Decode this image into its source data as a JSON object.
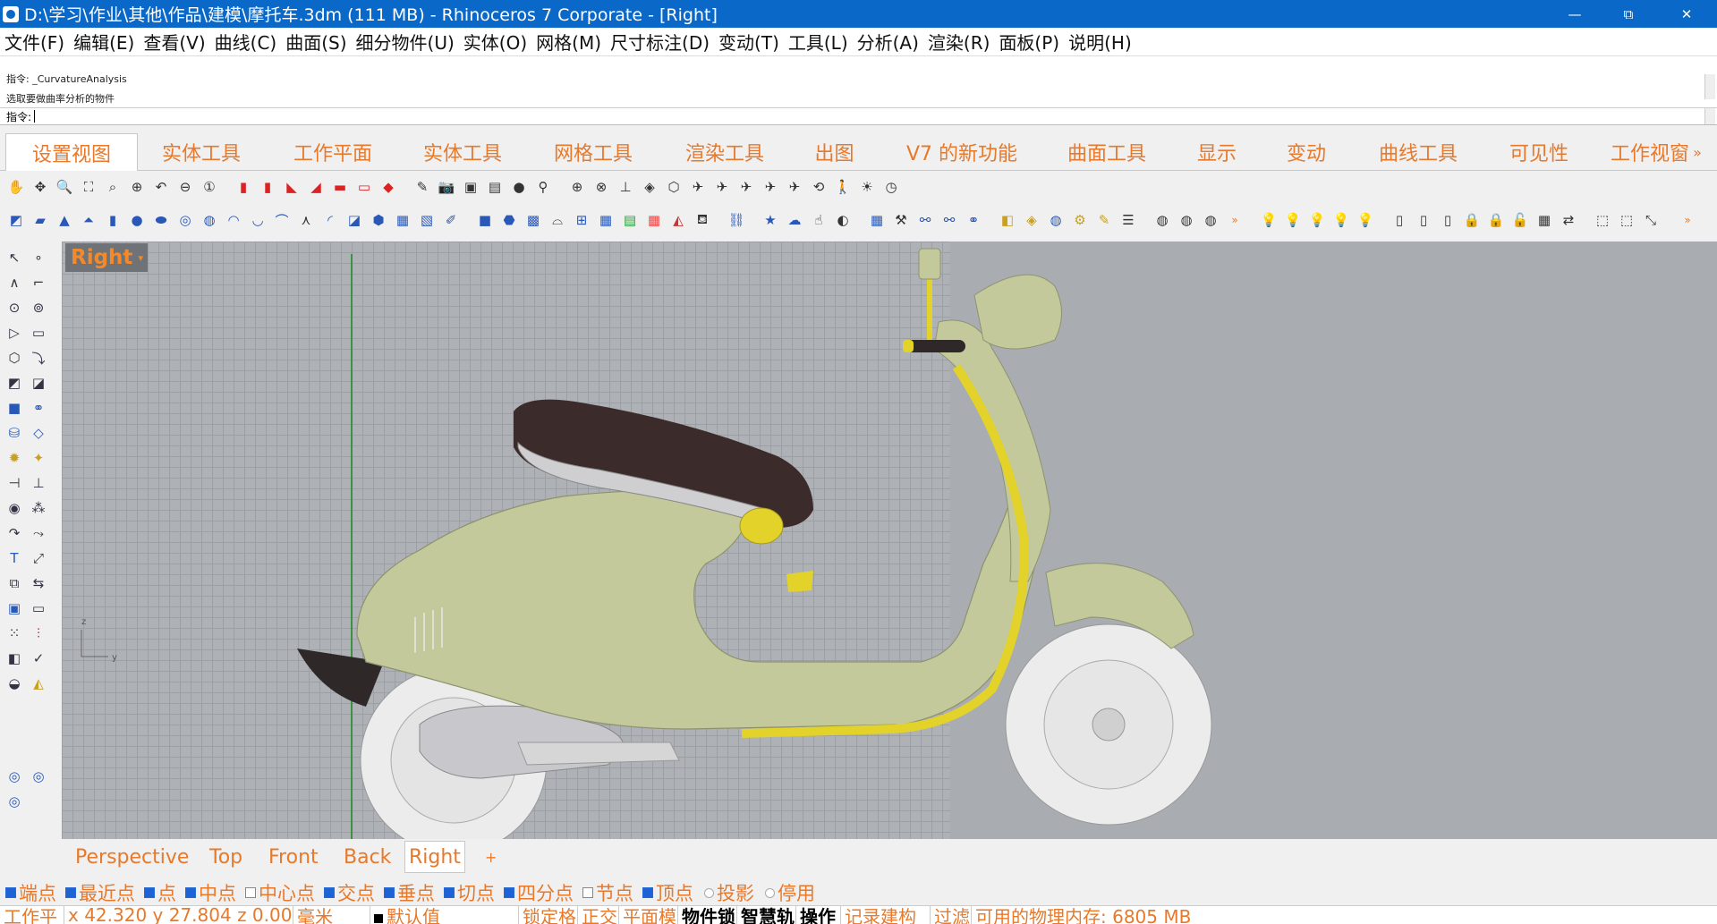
{
  "window": {
    "title": "D:\\学习\\作业\\其他\\作品\\建模\\摩托车.3dm (111 MB) - Rhinoceros 7 Corporate - [Right]",
    "controls": {
      "minimize": "—",
      "restore": "⧉",
      "close": "✕"
    }
  },
  "menu": [
    "文件(F)",
    "编辑(E)",
    "查看(V)",
    "曲线(C)",
    "曲面(S)",
    "细分物件(U)",
    "实体(O)",
    "网格(M)",
    "尺寸标注(D)",
    "变动(T)",
    "工具(L)",
    "分析(A)",
    "渲染(R)",
    "面板(P)",
    "说明(H)"
  ],
  "command_history": [
    "指令: _CurvatureAnalysis",
    "选取要做曲率分析的物件"
  ],
  "command_prompt": "指令:",
  "toolbar_tabs": [
    "设置视图",
    "实体工具",
    "工作平面",
    "实体工具",
    "网格工具",
    "渲染工具",
    "出图",
    "V7 的新功能",
    "曲面工具",
    "显示",
    "变动",
    "曲线工具",
    "可见性",
    "工作视窗"
  ],
  "toolbar_tab_overflow": "»",
  "viewport": {
    "label": "Right",
    "label_menu": "▾",
    "axis_z": "z",
    "axis_y": "y"
  },
  "viewport_tabs": [
    "Perspective",
    "Top",
    "Front",
    "Back",
    "Right"
  ],
  "viewport_add": "+",
  "osnaps": [
    {
      "label": "端点",
      "checked": true
    },
    {
      "label": "最近点",
      "checked": true
    },
    {
      "label": "点",
      "checked": true
    },
    {
      "label": "中点",
      "checked": true
    },
    {
      "label": "中心点",
      "checked": false
    },
    {
      "label": "交点",
      "checked": true
    },
    {
      "label": "垂点",
      "checked": true
    },
    {
      "label": "切点",
      "checked": true
    },
    {
      "label": "四分点",
      "checked": true
    },
    {
      "label": "节点",
      "checked": false
    },
    {
      "label": "顶点",
      "checked": true
    },
    {
      "label": "投影",
      "checked": false,
      "radio": true
    },
    {
      "label": "停用",
      "checked": false,
      "radio": true
    }
  ],
  "status": {
    "cplane": "工作平",
    "coords": "x 42.320 y 27.804 z 0.000",
    "units": "毫米",
    "layer": "默认值",
    "lock": "锁定格",
    "ortho": "正交",
    "planar": "平面模",
    "osnap": "物件锁",
    "smarttrack": "智慧轨",
    "gumball": "操作",
    "history": "记录建构",
    "filter": "过滤",
    "memory": "可用的物理内存: 6805 MB"
  },
  "colors": {
    "title_bg": "#0a68c8",
    "tab_text": "#e8792a",
    "viewport_bg": "#a9acb1",
    "scooter_body": "#c3c99a",
    "accent_yellow": "#e2d22a",
    "seat": "#3b2b2a",
    "wheel": "#ececec"
  }
}
